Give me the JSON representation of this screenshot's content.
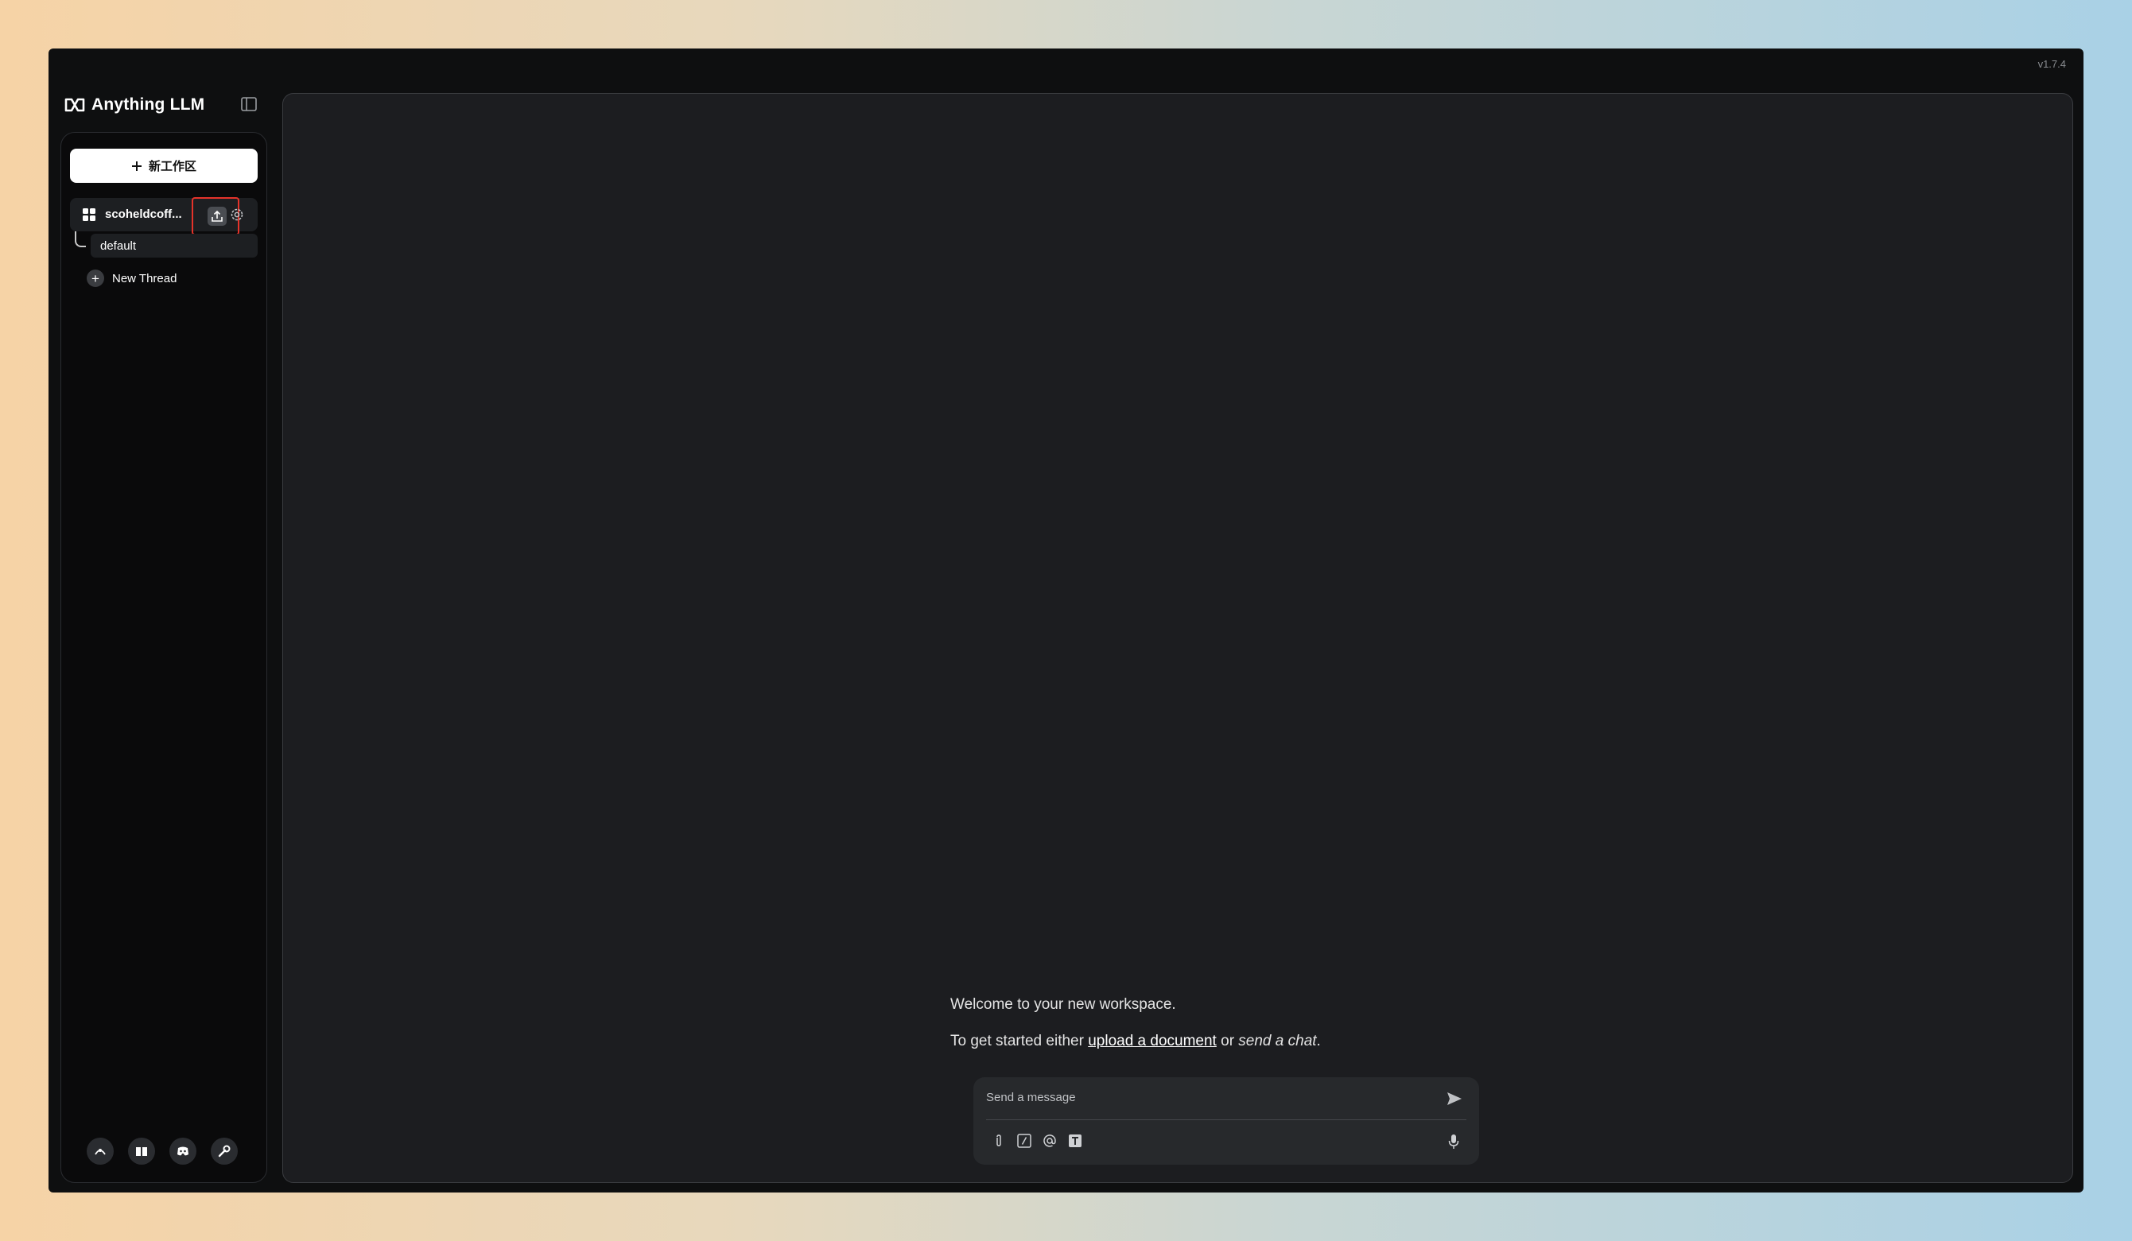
{
  "app": {
    "version": "v1.7.4",
    "brand": "Anything LLM"
  },
  "sidebar": {
    "new_workspace_label": "新工作区",
    "workspace": {
      "name": "scoheldcoff..."
    },
    "threads": [
      {
        "label": "default"
      }
    ],
    "new_thread_label": "New Thread"
  },
  "main": {
    "welcome_line1": "Welcome to your new workspace.",
    "welcome_prefix": "To get started either ",
    "welcome_link": "upload a document",
    "welcome_or": " or ",
    "welcome_chat": "send a chat",
    "welcome_suffix": "."
  },
  "composer": {
    "placeholder": "Send a message"
  },
  "colors": {
    "accent_highlight": "#e5332a",
    "panel": "#1c1d20",
    "window": "#0e0f10"
  }
}
